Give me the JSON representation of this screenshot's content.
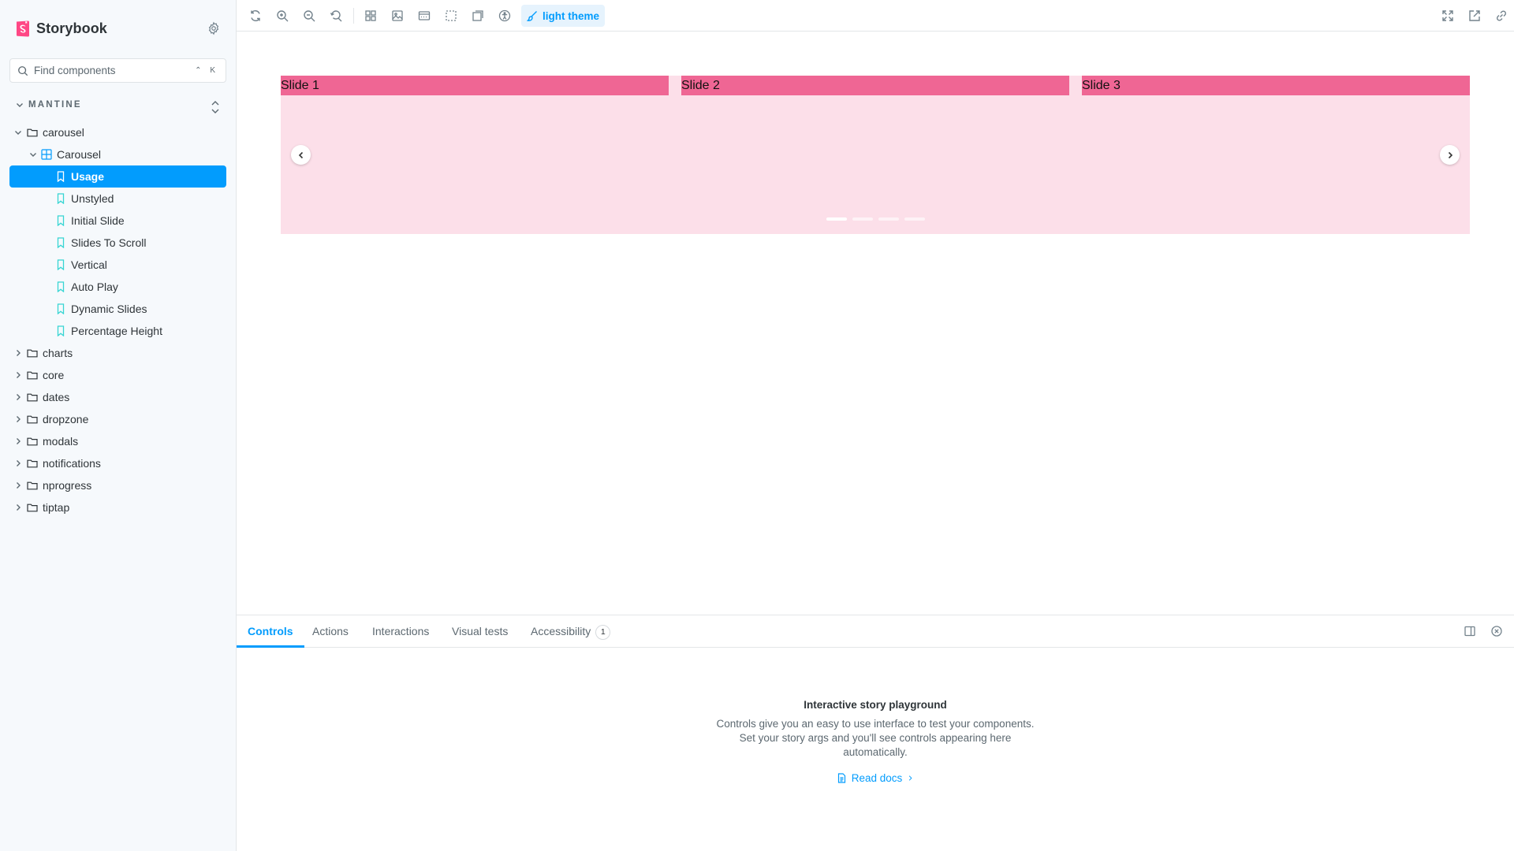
{
  "app": {
    "brand": "Storybook",
    "brand_color": "#ff4785",
    "accent": "#029cfd"
  },
  "sidebar": {
    "search_placeholder": "Find components",
    "search_shortcut": "⌃ K",
    "group_title": "MANTINE",
    "tree": [
      {
        "label": "carousel",
        "kind": "folder",
        "expanded": true
      },
      {
        "label": "Carousel",
        "kind": "component",
        "expanded": true
      },
      {
        "label": "Usage",
        "kind": "story",
        "selected": true
      },
      {
        "label": "Unstyled",
        "kind": "story"
      },
      {
        "label": "Initial Slide",
        "kind": "story"
      },
      {
        "label": "Slides To Scroll",
        "kind": "story"
      },
      {
        "label": "Vertical",
        "kind": "story"
      },
      {
        "label": "Auto Play",
        "kind": "story"
      },
      {
        "label": "Dynamic Slides",
        "kind": "story"
      },
      {
        "label": "Percentage Height",
        "kind": "story"
      },
      {
        "label": "charts",
        "kind": "folder"
      },
      {
        "label": "core",
        "kind": "folder"
      },
      {
        "label": "dates",
        "kind": "folder"
      },
      {
        "label": "dropzone",
        "kind": "folder"
      },
      {
        "label": "modals",
        "kind": "folder"
      },
      {
        "label": "notifications",
        "kind": "folder"
      },
      {
        "label": "nprogress",
        "kind": "folder"
      },
      {
        "label": "tiptap",
        "kind": "folder"
      }
    ]
  },
  "toolbar": {
    "theme_label": "light theme"
  },
  "preview": {
    "slides": [
      "Slide 1",
      "Slide 2",
      "Slide 3"
    ],
    "slide_color": "#ef6694",
    "carousel_bg": "#fcdfe9",
    "indicator_count": 4
  },
  "panel": {
    "tabs": {
      "controls": "Controls",
      "actions": "Actions",
      "interactions": "Interactions",
      "visual_tests": "Visual tests",
      "accessibility": "Accessibility",
      "accessibility_badge": "1"
    },
    "empty_title": "Interactive story playground",
    "empty_desc": "Controls give you an easy to use interface to test your components. Set your story args and you'll see controls appearing here automatically.",
    "read_docs": "Read docs"
  }
}
